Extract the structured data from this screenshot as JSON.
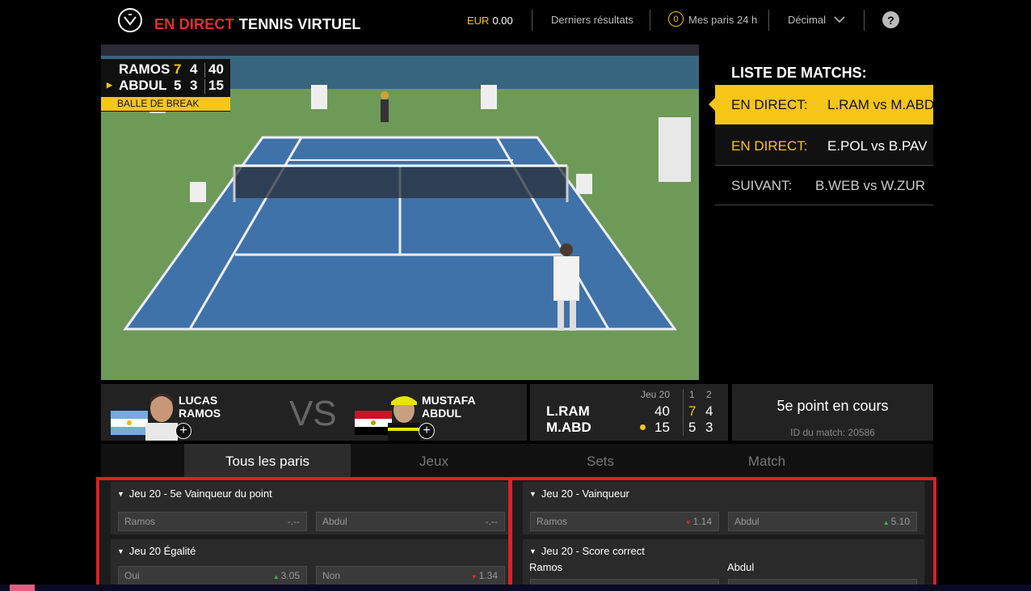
{
  "header": {
    "title_live": "EN DIRECT",
    "title_main": "TENNIS VIRTUEL",
    "currency": "EUR",
    "balance": "0.00",
    "recent_results": "Derniers résultats",
    "bets_count": "0",
    "my_bets": "Mes paris 24 h",
    "odds_format": "Décimal",
    "help": "?"
  },
  "scoreboard": {
    "rows": [
      {
        "name": "RAMOS",
        "set1": "7",
        "set2": "4",
        "points": "40",
        "serving": false
      },
      {
        "name": "ABDUL",
        "set1": "5",
        "set2": "3",
        "points": "15",
        "serving": true
      }
    ],
    "banner": "BALLE DE BREAK"
  },
  "match_list": {
    "title": "LISTE DE MATCHS:",
    "items": [
      {
        "label": "EN DIRECT:",
        "teams": "L.RAM vs M.ABD"
      },
      {
        "label": "EN DIRECT:",
        "teams": "E.POL vs B.PAV"
      },
      {
        "label": "SUIVANT:",
        "teams": "B.WEB vs W.ZUR"
      }
    ]
  },
  "players": {
    "p1_first": "LUCAS",
    "p1_last": "RAMOS",
    "vs": "VS",
    "p2_first": "MUSTAFA",
    "p2_last": "ABDUL",
    "plus": "+"
  },
  "live_score": {
    "game": "Jeu 20",
    "set_head_1": "1",
    "set_head_2": "2",
    "p1": "L.RAM",
    "p2": "M.ABD",
    "p1_points": "40",
    "p2_points": "15",
    "p1_s1": "7",
    "p1_s2": "4",
    "p2_s1": "5",
    "p2_s2": "3"
  },
  "point_info": {
    "status": "5e point en cours",
    "match_id": "ID du match: 20586"
  },
  "tabs": [
    "Tous les paris",
    "Jeux",
    "Sets",
    "Match"
  ],
  "markets": {
    "m1": {
      "title": "Jeu 20 - 5e Vainqueur du point",
      "a_label": "Ramos",
      "a_value": "-.--",
      "b_label": "Abdul",
      "b_value": "-.--"
    },
    "m2": {
      "title": "Jeu 20 Égalité",
      "a_label": "Oui",
      "a_value": "3.05",
      "b_label": "Non",
      "b_value": "1.34"
    },
    "m3": {
      "title": "Jeu 20 - Vainqueur",
      "a_label": "Ramos",
      "a_value": "1.14",
      "b_label": "Abdul",
      "b_value": "5.10"
    },
    "m4": {
      "title": "Jeu 20 - Score correct",
      "col_a": "Ramos",
      "col_b": "Abdul"
    }
  },
  "colors": {
    "accent": "#f5c518",
    "live_red": "#e0302a",
    "highlight_border": "#e01f26"
  }
}
